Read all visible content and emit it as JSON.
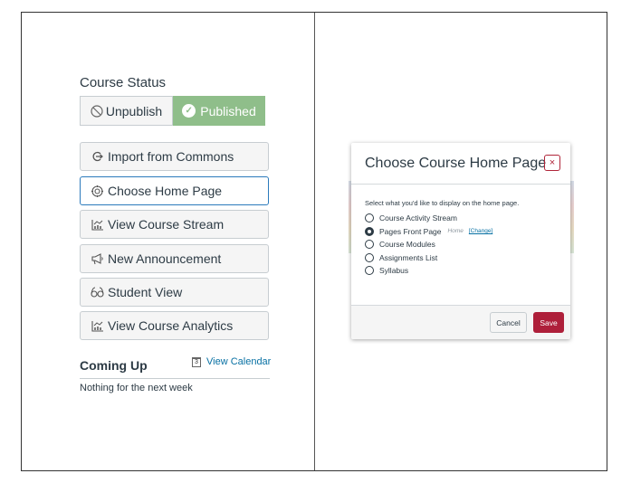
{
  "left_panel": {
    "course_status": {
      "title": "Course Status",
      "unpublish_label": "Unpublish",
      "unpublish_icon": "no-entry-icon",
      "published_label": "Published",
      "published_icon": "check-circle-icon",
      "published_color": "#8fbe8a"
    },
    "actions": [
      {
        "label": "Import from Commons",
        "icon": "commons-icon",
        "glyph": "⟴"
      },
      {
        "label": "Choose Home Page",
        "icon": "target-icon",
        "glyph": "◎",
        "focused": true
      },
      {
        "label": "View Course Stream",
        "icon": "stream-chart-icon",
        "glyph": "▥"
      },
      {
        "label": "New Announcement",
        "icon": "megaphone-icon",
        "glyph": "📢"
      },
      {
        "label": "Student View",
        "icon": "glasses-icon",
        "glyph": "6ə"
      },
      {
        "label": "View Course Analytics",
        "icon": "analytics-chart-icon",
        "glyph": "▥"
      }
    ],
    "coming_up": {
      "title": "Coming Up",
      "view_calendar_label": "View Calendar",
      "calendar_day": "3",
      "empty_text": "Nothing for the next week"
    }
  },
  "modal": {
    "title": "Choose Course Home Page",
    "close_label": "×",
    "prompt": "Select what you'd like to display on the home page.",
    "options": [
      {
        "label": "Course Activity Stream",
        "checked": false
      },
      {
        "label": "Pages Front Page",
        "checked": true,
        "sub_label": "Home",
        "change_label": "[Change]"
      },
      {
        "label": "Course Modules",
        "checked": false
      },
      {
        "label": "Assignments List",
        "checked": false
      },
      {
        "label": "Syllabus",
        "checked": false
      }
    ],
    "cancel_label": "Cancel",
    "save_label": "Save",
    "save_color": "#ae1f3a"
  }
}
